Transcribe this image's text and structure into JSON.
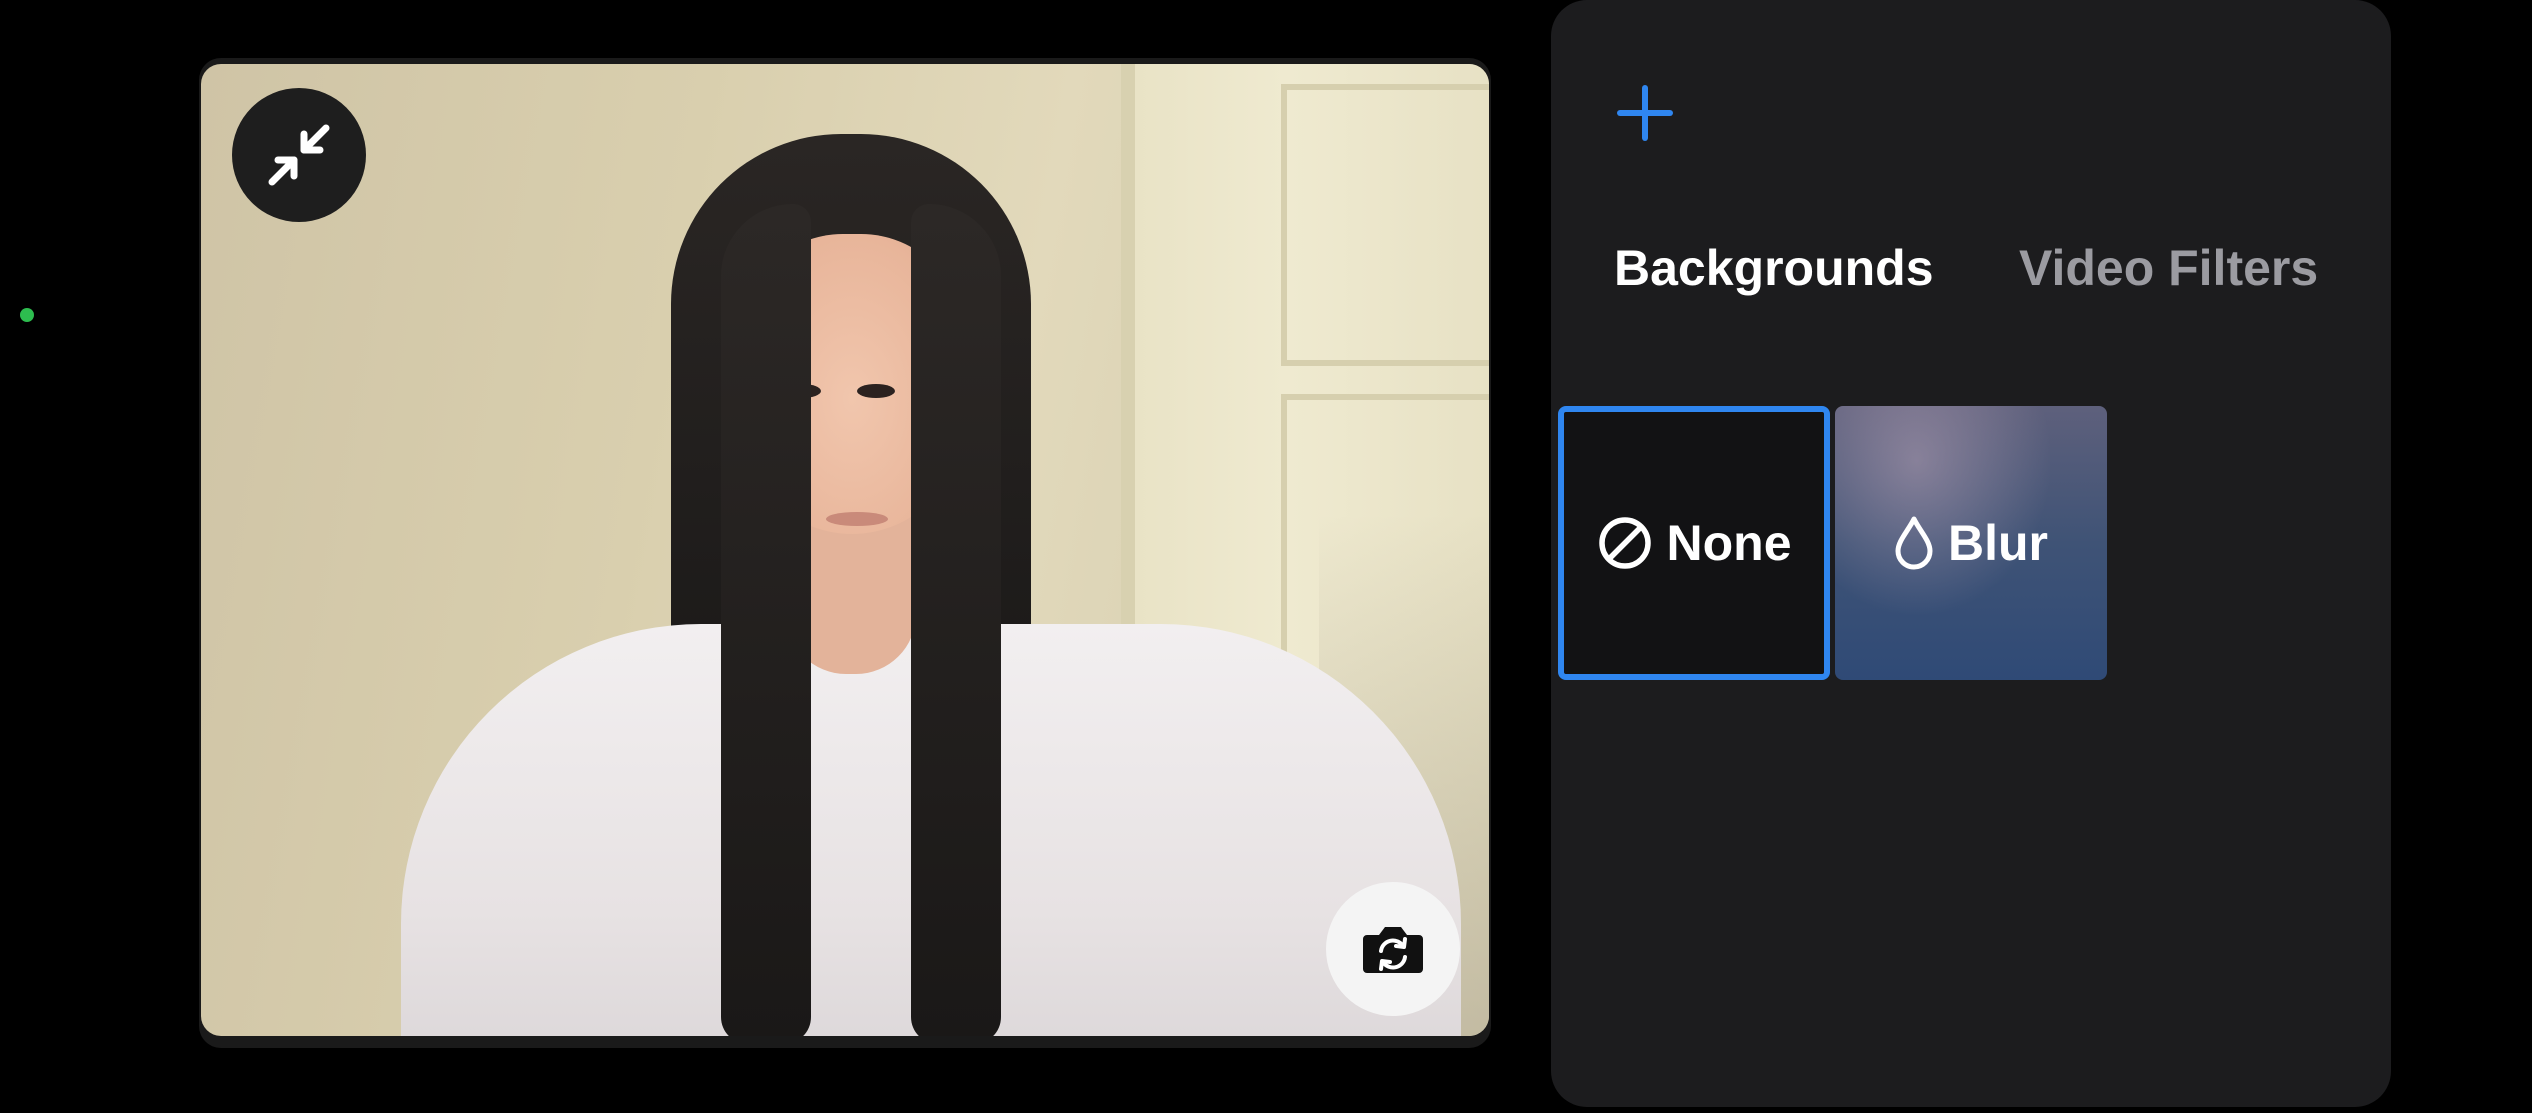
{
  "colors": {
    "accent": "#2f86f0",
    "status_dot": "#2dbd4f",
    "tab_active": "#ffffff",
    "tab_inactive": "#9b9ba1",
    "panel_bg": "#1c1c1e"
  },
  "video": {
    "minimize_icon": "minimize-arrows-icon",
    "flip_icon": "camera-flip-icon"
  },
  "panel": {
    "add_icon": "plus-icon",
    "tabs": [
      {
        "label": "Backgrounds",
        "active": true
      },
      {
        "label": "Video Filters",
        "active": false
      }
    ],
    "backgrounds": [
      {
        "label": "None",
        "icon": "no-symbol-icon",
        "selected": true
      },
      {
        "label": "Blur",
        "icon": "droplet-icon",
        "selected": false
      }
    ]
  }
}
